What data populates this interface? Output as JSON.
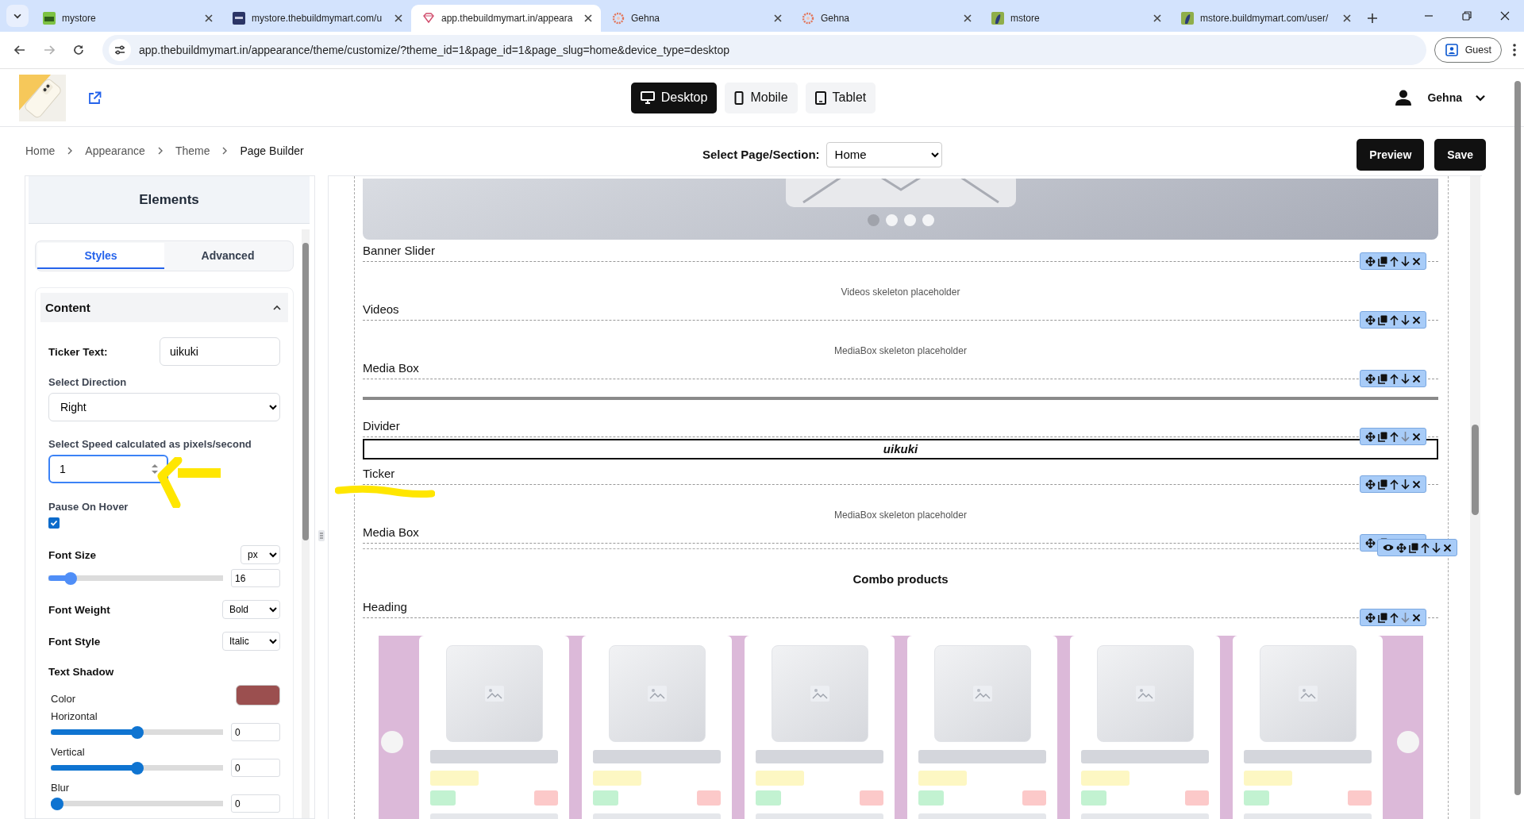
{
  "browser": {
    "tabs": [
      {
        "title": "mystore",
        "kind": "store",
        "selected": false
      },
      {
        "title": "mystore.thebuildmymart.com/u",
        "kind": "site",
        "selected": false
      },
      {
        "title": "app.thebuildmymart.in/appeara",
        "kind": "gem",
        "selected": true
      },
      {
        "title": "Gehna",
        "kind": "flower",
        "selected": false
      },
      {
        "title": "Gehna",
        "kind": "flower",
        "selected": false
      },
      {
        "title": "mstore",
        "kind": "bird",
        "selected": false
      },
      {
        "title": "mstore.buildmymart.com/user/",
        "kind": "bird",
        "selected": false
      }
    ],
    "forward_disabled": true,
    "url": "app.thebuildmymart.in/appearance/theme/customize/?theme_id=1&page_id=1&page_slug=home&device_type=desktop",
    "profile": "Guest"
  },
  "header": {
    "devices": [
      {
        "label": "Desktop",
        "kind": "desktop",
        "selected": true
      },
      {
        "label": "Mobile",
        "kind": "mobile",
        "selected": false
      },
      {
        "label": "Tablet",
        "kind": "tablet",
        "selected": false
      }
    ],
    "user": "Gehna"
  },
  "breadcrumb": [
    "Home",
    "Appearance",
    "Theme",
    "Page Builder"
  ],
  "page_select": {
    "label": "Select Page/Section:",
    "value": "Home"
  },
  "actions": [
    "Preview",
    "Save"
  ],
  "panel": {
    "title": "Elements",
    "tabs": [
      {
        "label": "Styles",
        "selected": true
      },
      {
        "label": "Advanced",
        "selected": false
      }
    ],
    "section": {
      "title": "Content",
      "expanded": true,
      "fields": [
        {
          "kind": "text-inline",
          "label": "Ticker Text:",
          "value": "uikuki"
        },
        {
          "kind": "select",
          "label": "Select Direction",
          "value": "Right"
        },
        {
          "kind": "number",
          "label": "Select Speed calculated as pixels/second",
          "value": "1",
          "focused": true
        },
        {
          "kind": "checkbox",
          "label": "Pause On Hover",
          "checked": true
        },
        {
          "kind": "slider-unit",
          "label": "Font Size",
          "unit": "px",
          "level": 0.1,
          "value": "16"
        },
        {
          "kind": "select-inline",
          "label": "Font Weight",
          "value": "Bold"
        },
        {
          "kind": "select-inline",
          "label": "Font Style",
          "value": "Italic"
        },
        {
          "kind": "heading",
          "label": "Text Shadow"
        },
        {
          "kind": "color",
          "label": "Color",
          "color": "#9b4f4f"
        },
        {
          "kind": "slider",
          "label": "Horizontal",
          "level": 0.5,
          "value": "0"
        },
        {
          "kind": "slider",
          "label": "Vertical",
          "level": 0.5,
          "value": "0"
        },
        {
          "kind": "slider",
          "label": "Blur",
          "level": 0,
          "value": "0"
        }
      ]
    }
  },
  "canvas": {
    "blocks": [
      {
        "kind": "banner",
        "label": "Banner Slider",
        "dots": [
          {
            "selected": true
          },
          {
            "selected": false
          },
          {
            "selected": false
          },
          {
            "selected": false
          }
        ],
        "down_disabled": false
      },
      {
        "kind": "placeholder",
        "text": "Videos skeleton placeholder",
        "label": "Videos",
        "down_disabled": false
      },
      {
        "kind": "placeholder",
        "text": "MediaBox skeleton placeholder",
        "label": "Media Box",
        "down_disabled": false
      },
      {
        "kind": "divider",
        "label": "Divider",
        "down_disabled": true
      },
      {
        "kind": "ticker",
        "text": "uikuki",
        "label": "Ticker",
        "down_disabled": false
      },
      {
        "kind": "placeholder",
        "text": "MediaBox skeleton placeholder",
        "label": "Media Box",
        "toolbar_covered": true
      }
    ],
    "section": {
      "heading": "Combo products",
      "label": "Heading",
      "down_disabled": true,
      "cards": [
        {
          "kind": "skeleton"
        },
        {
          "kind": "skeleton"
        },
        {
          "kind": "skeleton"
        },
        {
          "kind": "skeleton"
        },
        {
          "kind": "skeleton"
        },
        {
          "kind": "skeleton"
        }
      ]
    }
  }
}
